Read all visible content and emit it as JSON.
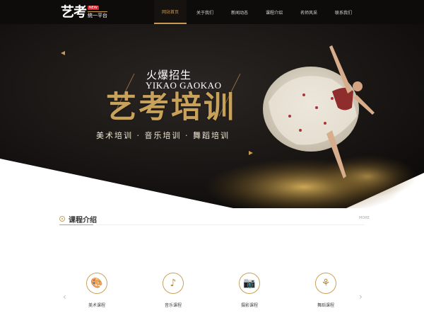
{
  "logo": {
    "main": "艺考",
    "tag": "统一平台",
    "badge": "NEW"
  },
  "nav": {
    "items": [
      "网站首页",
      "关于我们",
      "新闻动态",
      "课程介绍",
      "名师风采",
      "联系我们"
    ],
    "active_index": 0
  },
  "hero": {
    "sub_cn": "火爆招生",
    "sub_en": "YIKAO GAOKAO",
    "title": "艺考培训",
    "subjects": "美术培训 · 音乐培训 · 舞蹈培训"
  },
  "section": {
    "title": "课程介绍",
    "more": "MORE"
  },
  "courses": [
    {
      "label": "美术课程",
      "icon": "palette-icon",
      "glyph": "🎨"
    },
    {
      "label": "音乐课程",
      "icon": "music-note-icon",
      "glyph": "♪"
    },
    {
      "label": "摄影课程",
      "icon": "camera-icon",
      "glyph": "📷"
    },
    {
      "label": "舞蹈课程",
      "icon": "dance-icon",
      "glyph": "⚘"
    }
  ],
  "colors": {
    "accent": "#c99a53",
    "nav_bg": "#0e0c0b",
    "hero_bg": "#1b1816"
  }
}
